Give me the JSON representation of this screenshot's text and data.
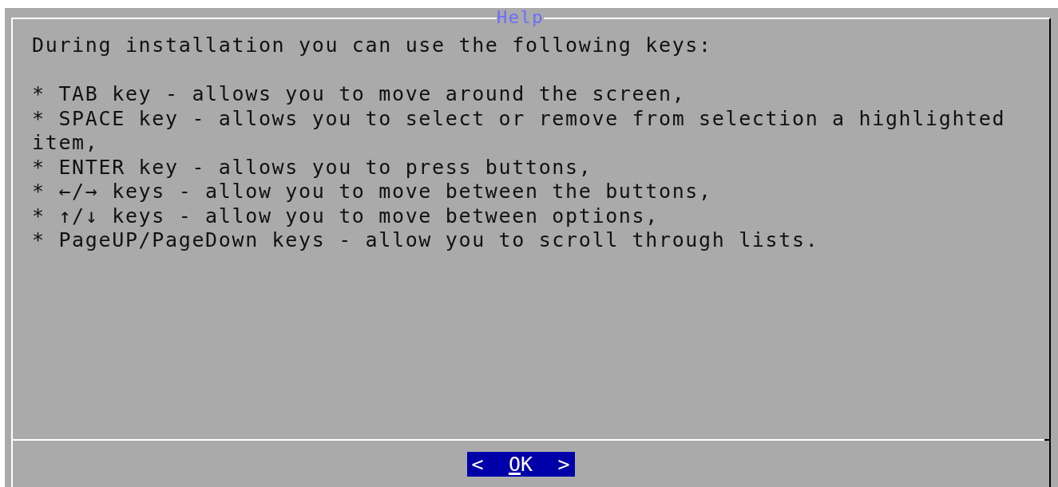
{
  "dialog": {
    "title": "Help",
    "intro": "During installation you can use the following keys:",
    "lines": [
      "* TAB key - allows you to move around the screen,",
      "* SPACE key - allows you to select or remove from selection a highlighted",
      "item,",
      "* ENTER key - allows you to press buttons,",
      "* ←/→ keys - allow you to move between the buttons,",
      "* ↑/↓ keys - allow you to move between options,",
      "* PageUP/PageDown keys - allow you to scroll through lists."
    ],
    "button": {
      "left": "<",
      "label": "OK",
      "right": ">",
      "focused": true
    }
  }
}
